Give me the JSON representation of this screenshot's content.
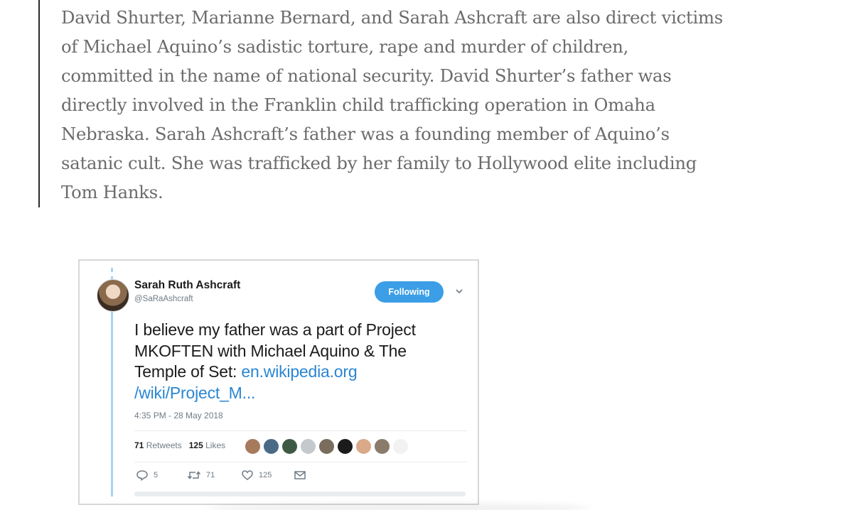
{
  "article": {
    "quote_lines": [
      "David Shurter, Marianne Bernard, and Sarah Ashcraft are also direct victims",
      "of Michael Aquino’s sadistic torture, rape and murder of children,",
      "committed in the name of national security. David Shurter’s father was",
      "directly involved in the Franklin child trafficking operation in Omaha",
      "Nebraska. Sarah Ashcraft’s father was a founding member of Aquino’s",
      "satanic cult. She was trafficked by her family to Hollywood elite including",
      "Tom Hanks."
    ]
  },
  "tweet": {
    "author_name": "Sarah Ruth Ashcraft",
    "author_handle": "@SaRaAshcraft",
    "follow_label": "Following",
    "text_lines": [
      "I believe my father was a part of Project",
      "MKOFTEN with Michael Aquino & The"
    ],
    "text_line3_prefix": "Temple of Set: ",
    "link_part1": "en.wikipedia.org",
    "link_part2": "/wiki/Project_M...",
    "timestamp": "4:35 PM - 28 May 2018",
    "retweets_count": "71",
    "retweets_label": "Retweets",
    "likes_count": "125",
    "likes_label": "Likes",
    "reply_count": "5",
    "retweet_action_count": "71",
    "like_action_count": "125",
    "accent_color": "#3b9ee6",
    "link_color": "#2a86d3",
    "icons": [
      "chevron-down-icon",
      "reply-icon",
      "retweet-icon",
      "heart-icon",
      "envelope-icon"
    ]
  }
}
